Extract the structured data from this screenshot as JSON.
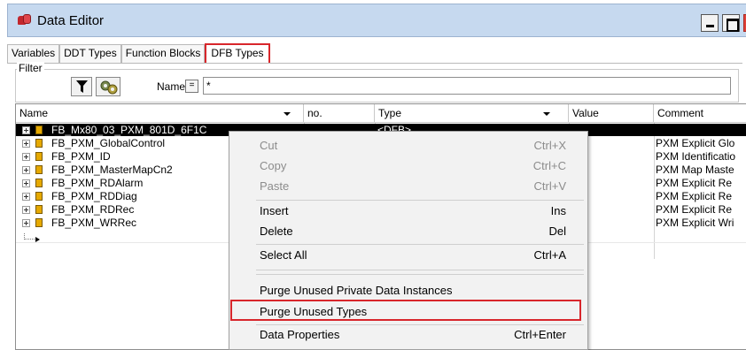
{
  "window": {
    "title": "Data Editor",
    "close_glyph": "x"
  },
  "tabs": [
    {
      "label": "Variables"
    },
    {
      "label": "DDT Types"
    },
    {
      "label": "Function Blocks"
    },
    {
      "label": "DFB Types"
    }
  ],
  "filter": {
    "group_label": "Filter",
    "name_label": "Name",
    "eq_label": "=",
    "value": "*"
  },
  "grid": {
    "columns": {
      "name": "Name",
      "no": "no.",
      "type": "Type",
      "value": "Value",
      "comment": "Comment"
    },
    "rows": [
      {
        "name": "FB_Mx80_03_PXM_801D_6F1C",
        "type": "<DFB>",
        "comment": ""
      },
      {
        "name": "FB_PXM_GlobalControl",
        "type": "",
        "comment": "PXM Explicit Glo"
      },
      {
        "name": "FB_PXM_ID",
        "type": "",
        "comment": "PXM Identificatio"
      },
      {
        "name": "FB_PXM_MasterMapCn2",
        "type": "",
        "comment": "PXM Map Maste"
      },
      {
        "name": "FB_PXM_RDAlarm",
        "type": "",
        "comment": "PXM Explicit Re"
      },
      {
        "name": "FB_PXM_RDDiag",
        "type": "",
        "comment": "PXM Explicit Re"
      },
      {
        "name": "FB_PXM_RDRec",
        "type": "",
        "comment": "PXM Explicit Re"
      },
      {
        "name": "FB_PXM_WRRec",
        "type": "",
        "comment": "PXM Explicit Wri"
      }
    ]
  },
  "context_menu": {
    "cut": {
      "label": "Cut",
      "shortcut": "Ctrl+X"
    },
    "copy": {
      "label": "Copy",
      "shortcut": "Ctrl+C"
    },
    "paste": {
      "label": "Paste",
      "shortcut": "Ctrl+V"
    },
    "insert": {
      "label": "Insert",
      "shortcut": "Ins"
    },
    "delete": {
      "label": "Delete",
      "shortcut": "Del"
    },
    "select_all": {
      "label": "Select All",
      "shortcut": "Ctrl+A"
    },
    "purge_private": {
      "label": "Purge Unused Private Data Instances"
    },
    "purge_types": {
      "label": "Purge Unused Types"
    },
    "data_properties": {
      "label": "Data Properties",
      "shortcut": "Ctrl+Enter"
    }
  },
  "colors": {
    "highlight": "#d8262b",
    "titlebar": "#c6d9ef"
  }
}
